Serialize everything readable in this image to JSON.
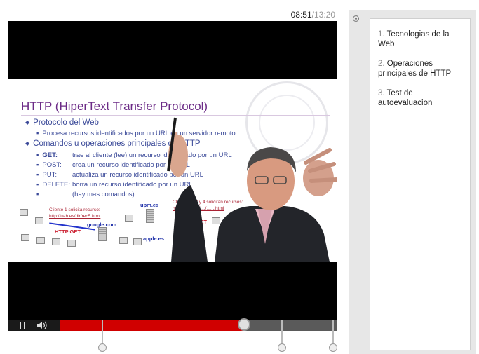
{
  "player": {
    "time_current": "08:51",
    "time_separator": "/",
    "time_total": "13:20",
    "progress_fraction": 0.664,
    "chapter_marker_fractions": [
      0.15,
      0.8,
      0.985
    ],
    "controls": {
      "play_icon": "pause-icon",
      "volume_icon": "volume-icon"
    },
    "colors": {
      "progress": "#d00000",
      "track": "#5a5a5a",
      "title": "#6b2a86",
      "body_text": "#3b4a99"
    }
  },
  "slide": {
    "title": "HTTP (HiperText Transfer Protocol)",
    "bullets": [
      {
        "text": "Protocolo del Web"
      },
      {
        "text": "Procesa recursos identificados por un URL en un servidor remoto"
      },
      {
        "text": "Comandos u operaciones principales de HTTP"
      }
    ],
    "commands": [
      {
        "name": "GET:",
        "desc": "trae al cliente (lee) un recurso identificado por un URL"
      },
      {
        "name": "POST:",
        "desc": "crea un recurso identificado por un URL"
      },
      {
        "name": "PUT:",
        "desc": "actualiza un recurso identificado por un URL"
      },
      {
        "name": "DELETE:",
        "desc": "borra un recurso identificado por un URL"
      },
      {
        "name": "........",
        "desc": "(hay mas comandos)"
      }
    ],
    "diagram": {
      "client1_line1": "Cliente 1 solicita recurso:",
      "client1_line2": "http://uah.es/dir/rec5.html",
      "google": "google.com",
      "http_get_1": "HTTP GET",
      "upm": "upm.es",
      "clients234_line1": "Clientes 2, 3 y 4 solicitan recursos:",
      "clients234_line2": "http://upm.es/..../.......html",
      "http_get_2": "HTTP GET",
      "apple": "apple.es"
    }
  },
  "sidebar": {
    "tab_icon": "chapters-icon",
    "chapters": [
      {
        "num": "1.",
        "label": "Tecnologias de la Web"
      },
      {
        "num": "2.",
        "label": "Operaciones principales de HTTP"
      },
      {
        "num": "3.",
        "label": "Test de autoevaluacion"
      }
    ]
  }
}
